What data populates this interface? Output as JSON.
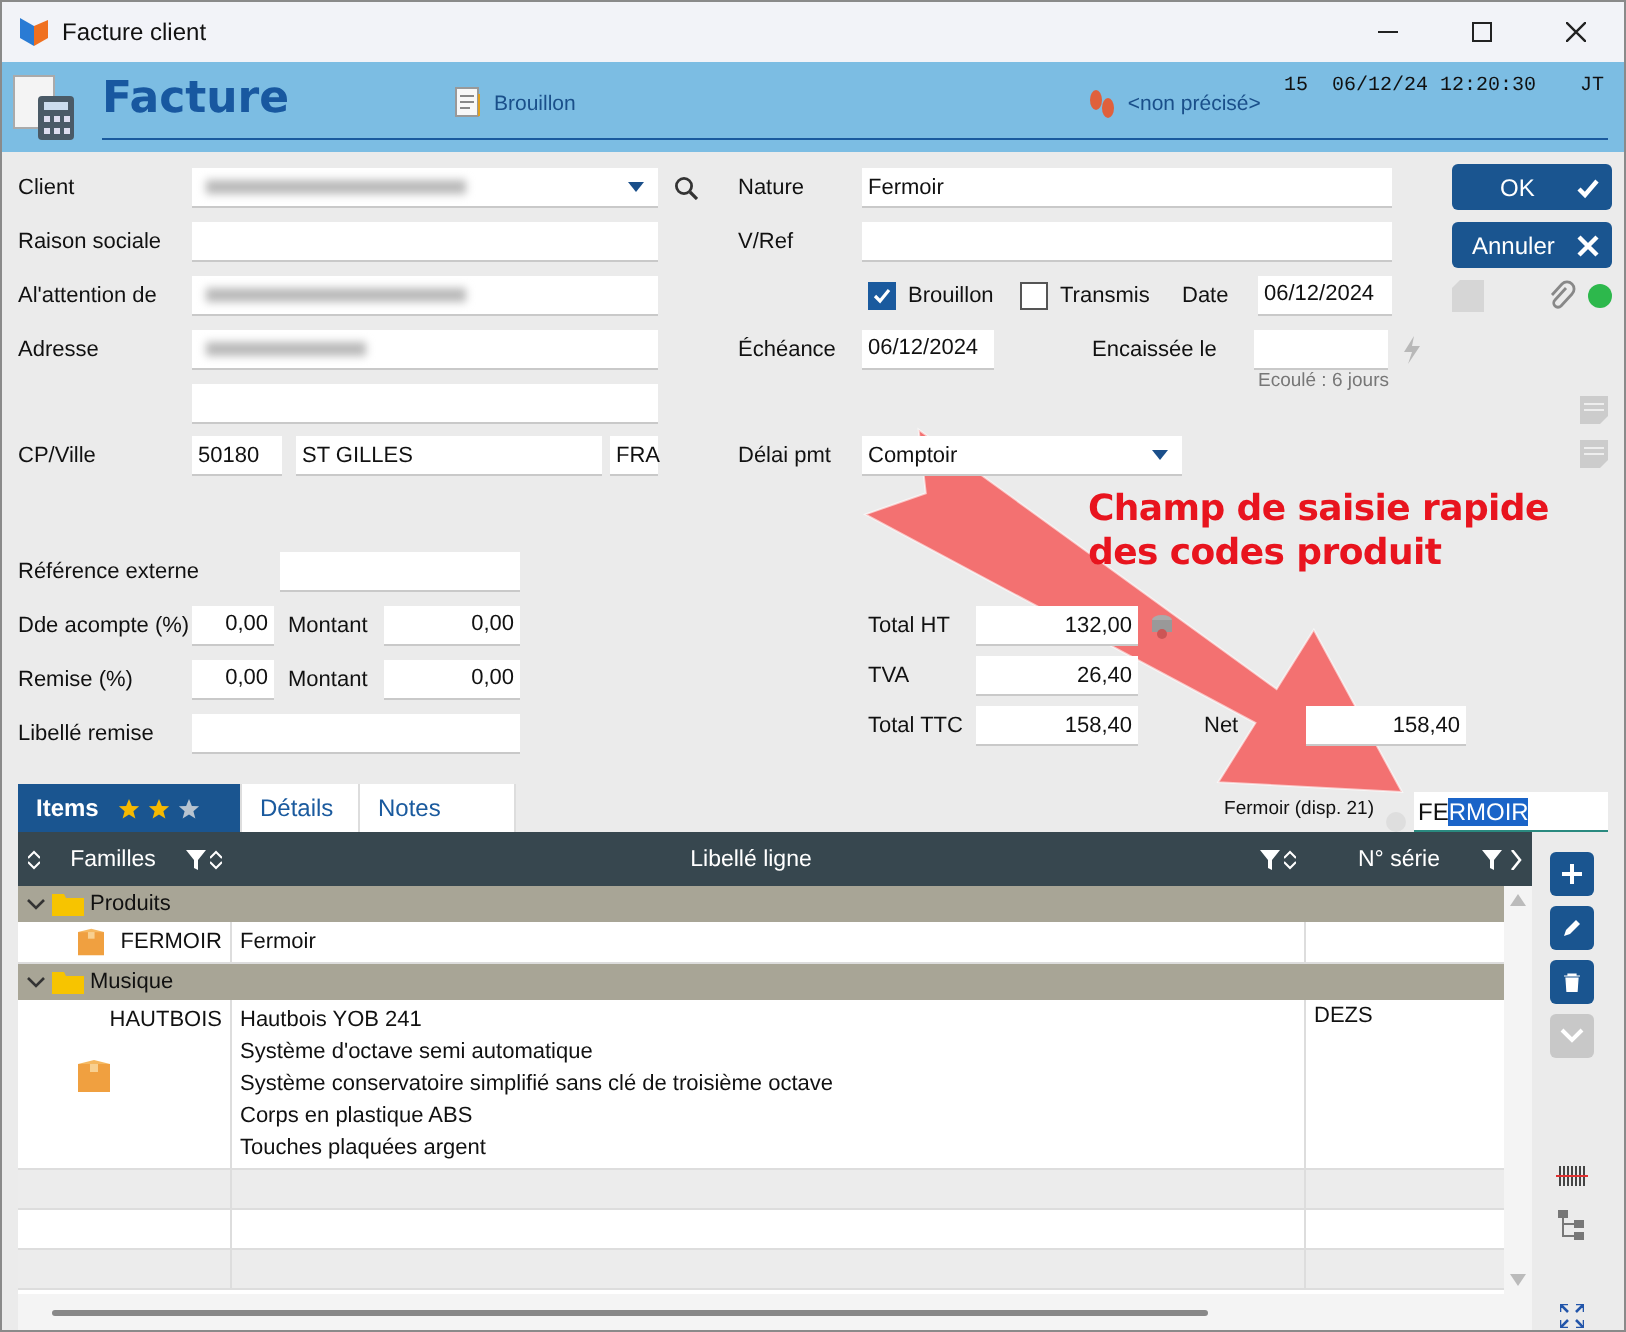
{
  "window": {
    "title": "Facture client"
  },
  "header": {
    "title": "Facture",
    "status": "Brouillon",
    "author": "<non précisé>",
    "number": "15",
    "timestamp": "06/12/24 12:20:30",
    "user": "JT"
  },
  "client": {
    "label": "Client",
    "redacted": true
  },
  "raison_sociale": {
    "label": "Raison sociale"
  },
  "attention": {
    "label": "Al'attention de",
    "redacted": true
  },
  "adresse": {
    "label": "Adresse",
    "redacted": true
  },
  "cp_ville": {
    "label": "CP/Ville",
    "postal_code": "50180",
    "city": "ST GILLES",
    "country": "FRA"
  },
  "reference_externe": {
    "label": "Référence externe"
  },
  "acompte": {
    "label": "Dde acompte (%)",
    "percent": "0,00",
    "amount_label": "Montant",
    "amount": "0,00"
  },
  "remise": {
    "label": "Remise (%)",
    "percent": "0,00",
    "amount_label": "Montant",
    "amount": "0,00"
  },
  "libelle_remise": {
    "label": "Libellé remise"
  },
  "nature": {
    "label": "Nature",
    "value": "Fermoir"
  },
  "vref": {
    "label": "V/Ref"
  },
  "flags": [
    {
      "label": "Brouillon",
      "checked": true
    },
    {
      "label": "Transmis",
      "checked": false
    }
  ],
  "date": {
    "label": "Date",
    "value": "06/12/2024"
  },
  "echeance": {
    "label": "Échéance",
    "value": "06/12/2024"
  },
  "encaissee": {
    "label": "Encaissée le",
    "note": "Ecoulé : 6 jours"
  },
  "delai": {
    "label": "Délai pmt",
    "value": "Comptoir"
  },
  "totals": [
    {
      "label": "Total HT",
      "value": "132,00"
    },
    {
      "label": "TVA",
      "value": "26,40"
    },
    {
      "label": "Total TTC",
      "value": "158,40"
    }
  ],
  "net": {
    "label": "Net",
    "value": "158,40"
  },
  "buttons": [
    {
      "label": "OK",
      "kind": "ok"
    },
    {
      "label": "Annuler",
      "kind": "cancel"
    }
  ],
  "annotation": {
    "text": "Champ de saisie rapide des codes produit"
  },
  "tabs": [
    {
      "label": "Items",
      "selected": true,
      "stars": 2
    },
    {
      "label": "Détails",
      "selected": false
    },
    {
      "label": "Notes",
      "selected": false
    }
  ],
  "quick_entry": {
    "hint": "Fermoir (disp. 21)",
    "typed": "FE",
    "selected_text": "RMOIR"
  },
  "table": {
    "columns": [
      {
        "label": "Familles"
      },
      {
        "label": "Libellé ligne"
      },
      {
        "label": "N° série"
      }
    ],
    "groups": [
      {
        "name": "Produits",
        "expanded": true,
        "rows": [
          {
            "code": "FERMOIR",
            "lines": [
              "Fermoir"
            ]
          }
        ]
      },
      {
        "name": "Musique",
        "expanded": true,
        "rows": [
          {
            "code": "HAUTBOIS",
            "lines": [
              "Hautbois YOB 241",
              "Système d'octave semi automatique",
              "Système conservatoire simplifié sans clé de troisième octave",
              "Corps en plastique ABS",
              "Touches plaquées argent"
            ],
            "serial": "DEZS"
          }
        ]
      }
    ]
  }
}
